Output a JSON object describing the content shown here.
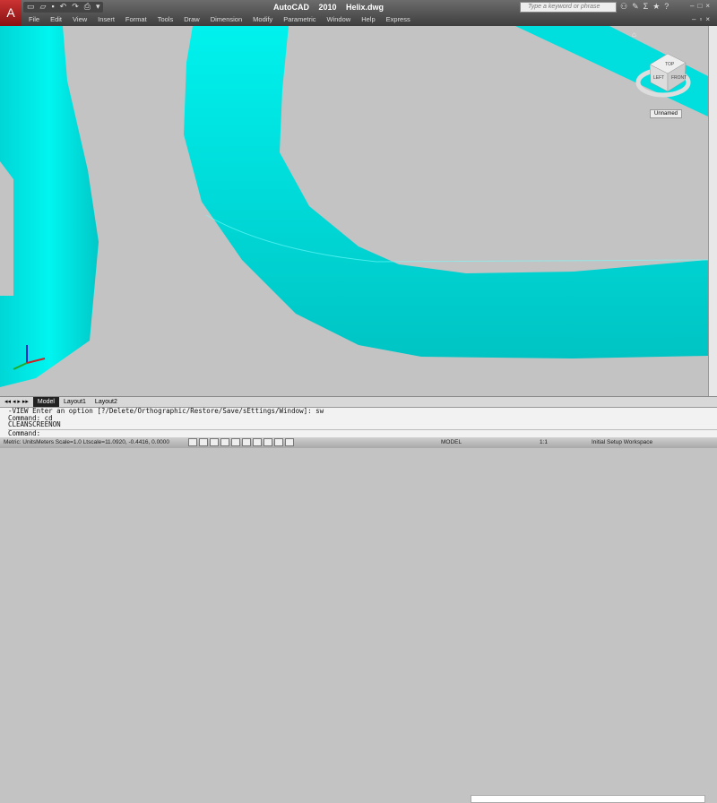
{
  "title": {
    "app": "AutoCAD 2010",
    "file": "Helix.dwg"
  },
  "menu": [
    "File",
    "Edit",
    "View",
    "Insert",
    "Format",
    "Tools",
    "Draw",
    "Dimension",
    "Modify",
    "Parametric",
    "Window",
    "Help",
    "Express"
  ],
  "search": {
    "placeholder": "Type a keyword or phrase"
  },
  "viewcube": {
    "top": "TOP",
    "left": "LEFT",
    "front": "FRONT",
    "ucs": "Unnamed"
  },
  "tabs": [
    "Model",
    "Layout1",
    "Layout2"
  ],
  "command": {
    "lines": [
      "-VIEW Enter an option [?/Delete/Orthographic/Restore/Save/sEttings/Window]: sw",
      "Command: cd",
      "CLEANSCREENON"
    ],
    "prompt": "Command:"
  },
  "status": {
    "units": "Metric: UnitsMeters  Scale=1.0  Ltscale=1",
    "coords": "1.0920, -0.4416, 0.0000",
    "model": "MODEL",
    "annoscale": "1:1",
    "workspace": "Initial Setup Workspace"
  },
  "colors": {
    "solid": "#00e6e6",
    "background": "#c3c3c3"
  }
}
